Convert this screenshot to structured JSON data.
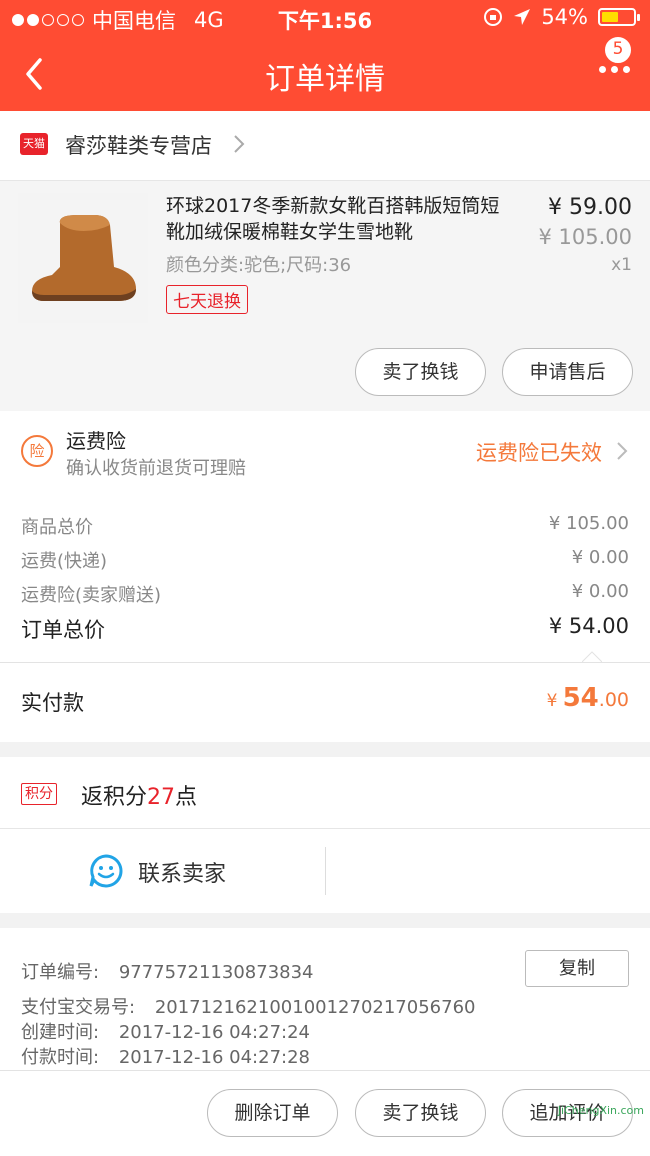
{
  "status_bar": {
    "carrier": "中国电信",
    "network": "4G",
    "time": "下午1:56",
    "battery": "54%",
    "battery_level": 0.54
  },
  "header": {
    "title": "订单详情",
    "badge_count": "5",
    "icons": {
      "back": "chevron-left-icon",
      "more": "more-dots-icon"
    }
  },
  "shop": {
    "platform_badge": "天猫",
    "name": "睿莎鞋类专营店"
  },
  "product": {
    "title": "环球2017冬季新款女靴百搭韩版短筒短靴加绒保暖棉鞋女学生雪地靴",
    "sku": "颜色分类:驼色;尺码:36",
    "tag": "七天退换",
    "price": "¥ 59.00",
    "original_price": "¥ 105.00",
    "quantity": "x1",
    "buttons": {
      "resell": "卖了换钱",
      "after_sale": "申请售后"
    }
  },
  "insurance": {
    "icon_text": "险",
    "title": "运费险",
    "subtitle": "确认收货前退货可理赔",
    "status": "运费险已失效"
  },
  "price_details": {
    "rows": [
      {
        "label": "商品总价",
        "value": "¥ 105.00"
      },
      {
        "label": "运费(快递)",
        "value": "¥ 0.00"
      },
      {
        "label": "运费险(卖家赠送)",
        "value": "¥ 0.00"
      }
    ],
    "total": {
      "label": "订单总价",
      "value": "¥ 54.00"
    },
    "paid": {
      "label": "实付款",
      "currency": "¥",
      "integer": "54",
      "decimal": ".00"
    }
  },
  "points": {
    "badge": "积分",
    "prefix": "返积分",
    "count": "27",
    "suffix": "点"
  },
  "contact": {
    "label": "联系卖家"
  },
  "order_info": {
    "order_no_label": "订单编号:",
    "order_no": "97775721130873834",
    "copy_label": "复制",
    "alipay_label": "支付宝交易号:",
    "alipay_no": "2017121621001001270217056760",
    "created_label": "创建时间:",
    "created": "2017-12-16 04:27:24",
    "paid_label": "付款时间:",
    "paid": "2017-12-16 04:27:28"
  },
  "bottom_bar": {
    "delete": "删除订单",
    "resell": "卖了换钱",
    "review": "追加评价"
  },
  "watermark": "JiChengXin.com",
  "colors": {
    "header": "#ff4c33",
    "accent_orange": "#f4793b",
    "tmall_red": "#e8232b",
    "contact_blue": "#21a4e6"
  }
}
